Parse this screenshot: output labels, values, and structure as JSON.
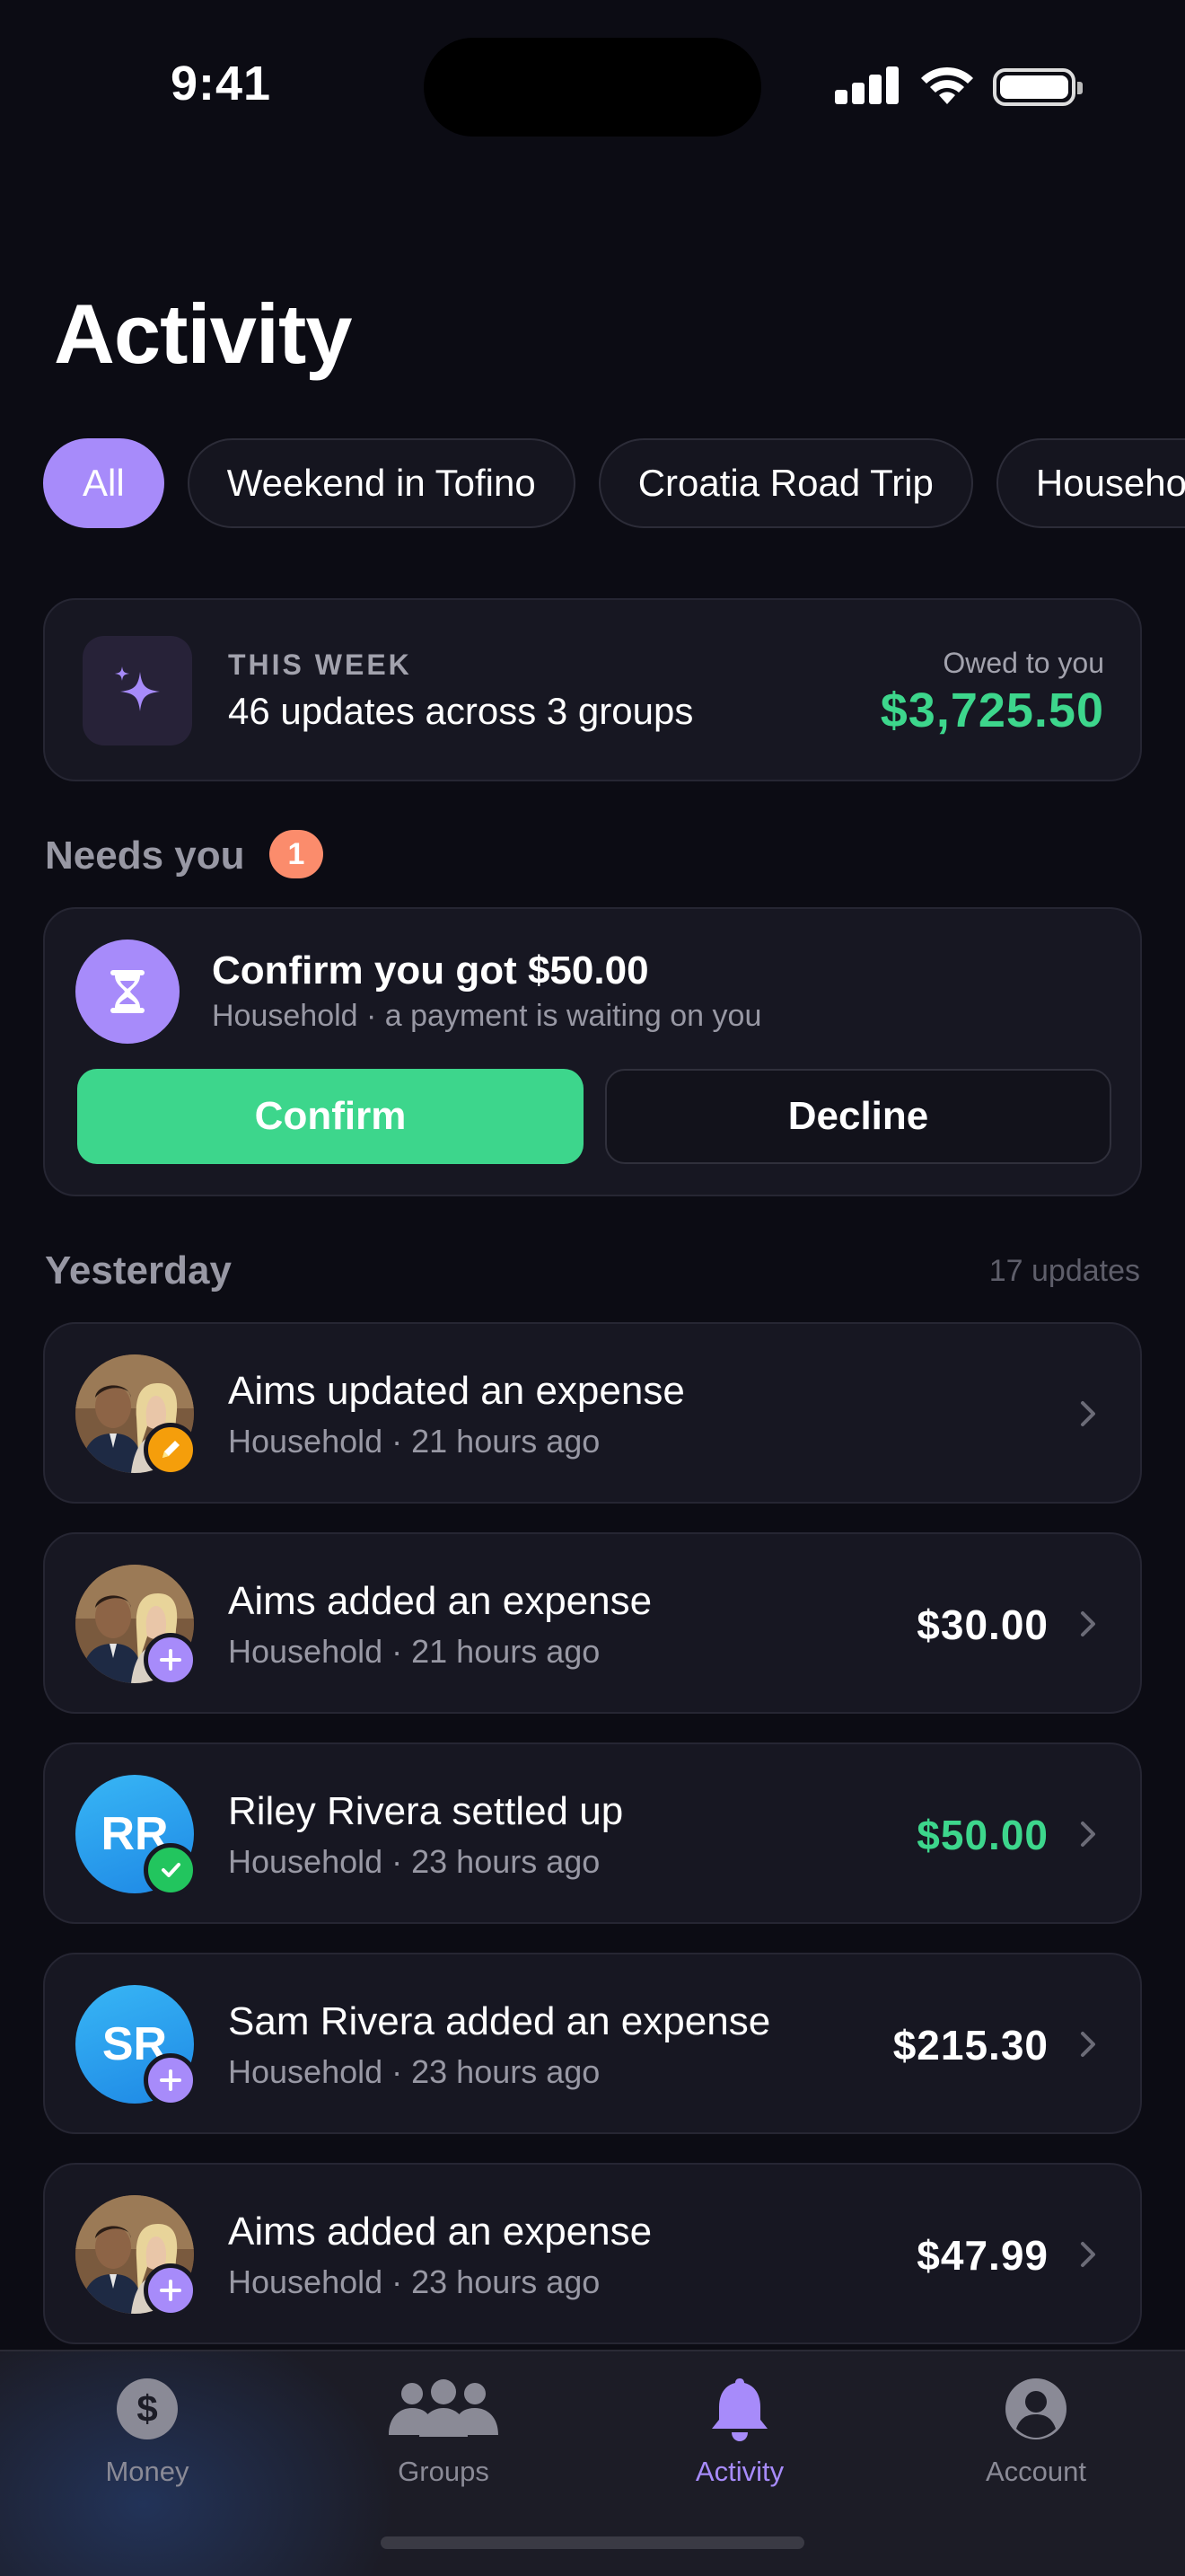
{
  "status_bar": {
    "time": "9:41"
  },
  "page": {
    "title": "Activity"
  },
  "filters": {
    "chips": [
      "All",
      "Weekend in Tofino",
      "Croatia Road Trip",
      "Household"
    ],
    "active": "All"
  },
  "summary": {
    "kicker": "THIS WEEK",
    "text": "46 updates across 3 groups",
    "owed_label": "Owed to you",
    "owed_amount": "$3,725.50",
    "icon": "sparkles-icon"
  },
  "needs_you": {
    "label": "Needs you",
    "count": "1",
    "card": {
      "title": "Confirm you got $50.00",
      "subtitle": "Household · a payment is waiting on you",
      "icon": "hourglass-icon",
      "confirm_label": "Confirm",
      "decline_label": "Decline"
    }
  },
  "yesterday": {
    "label": "Yesterday",
    "count_text": "17 updates",
    "items": [
      {
        "title": "Aims updated an expense",
        "group": "Household",
        "time": "21 hours ago",
        "amount": "",
        "avatar": "photo",
        "badge": "edit"
      },
      {
        "title": "Aims added an expense",
        "group": "Household",
        "time": "21 hours ago",
        "amount": "$30.00",
        "avatar": "photo",
        "badge": "add"
      },
      {
        "title": "Riley Rivera settled up",
        "group": "Household",
        "time": "23 hours ago",
        "amount": "$50.00",
        "avatar": "RR",
        "badge": "check"
      },
      {
        "title": "Sam Rivera added an expense",
        "group": "Household",
        "time": "23 hours ago",
        "amount": "$215.30",
        "avatar": "SR",
        "badge": "add"
      },
      {
        "title": "Aims added an expense",
        "group": "Household",
        "time": "23 hours ago",
        "amount": "$47.99",
        "avatar": "photo",
        "badge": "add"
      }
    ]
  },
  "tab_bar": {
    "tabs": [
      {
        "label": "Money",
        "icon": "dollar-icon"
      },
      {
        "label": "Groups",
        "icon": "people-icon"
      },
      {
        "label": "Activity",
        "icon": "bell-icon"
      },
      {
        "label": "Account",
        "icon": "person-icon"
      }
    ],
    "active": "Activity"
  },
  "colors": {
    "accent": "#a78bfa",
    "positive": "#3dd68c",
    "badge_orange": "#fb8c6c",
    "background": "#0c0c14",
    "card": "#171722"
  }
}
